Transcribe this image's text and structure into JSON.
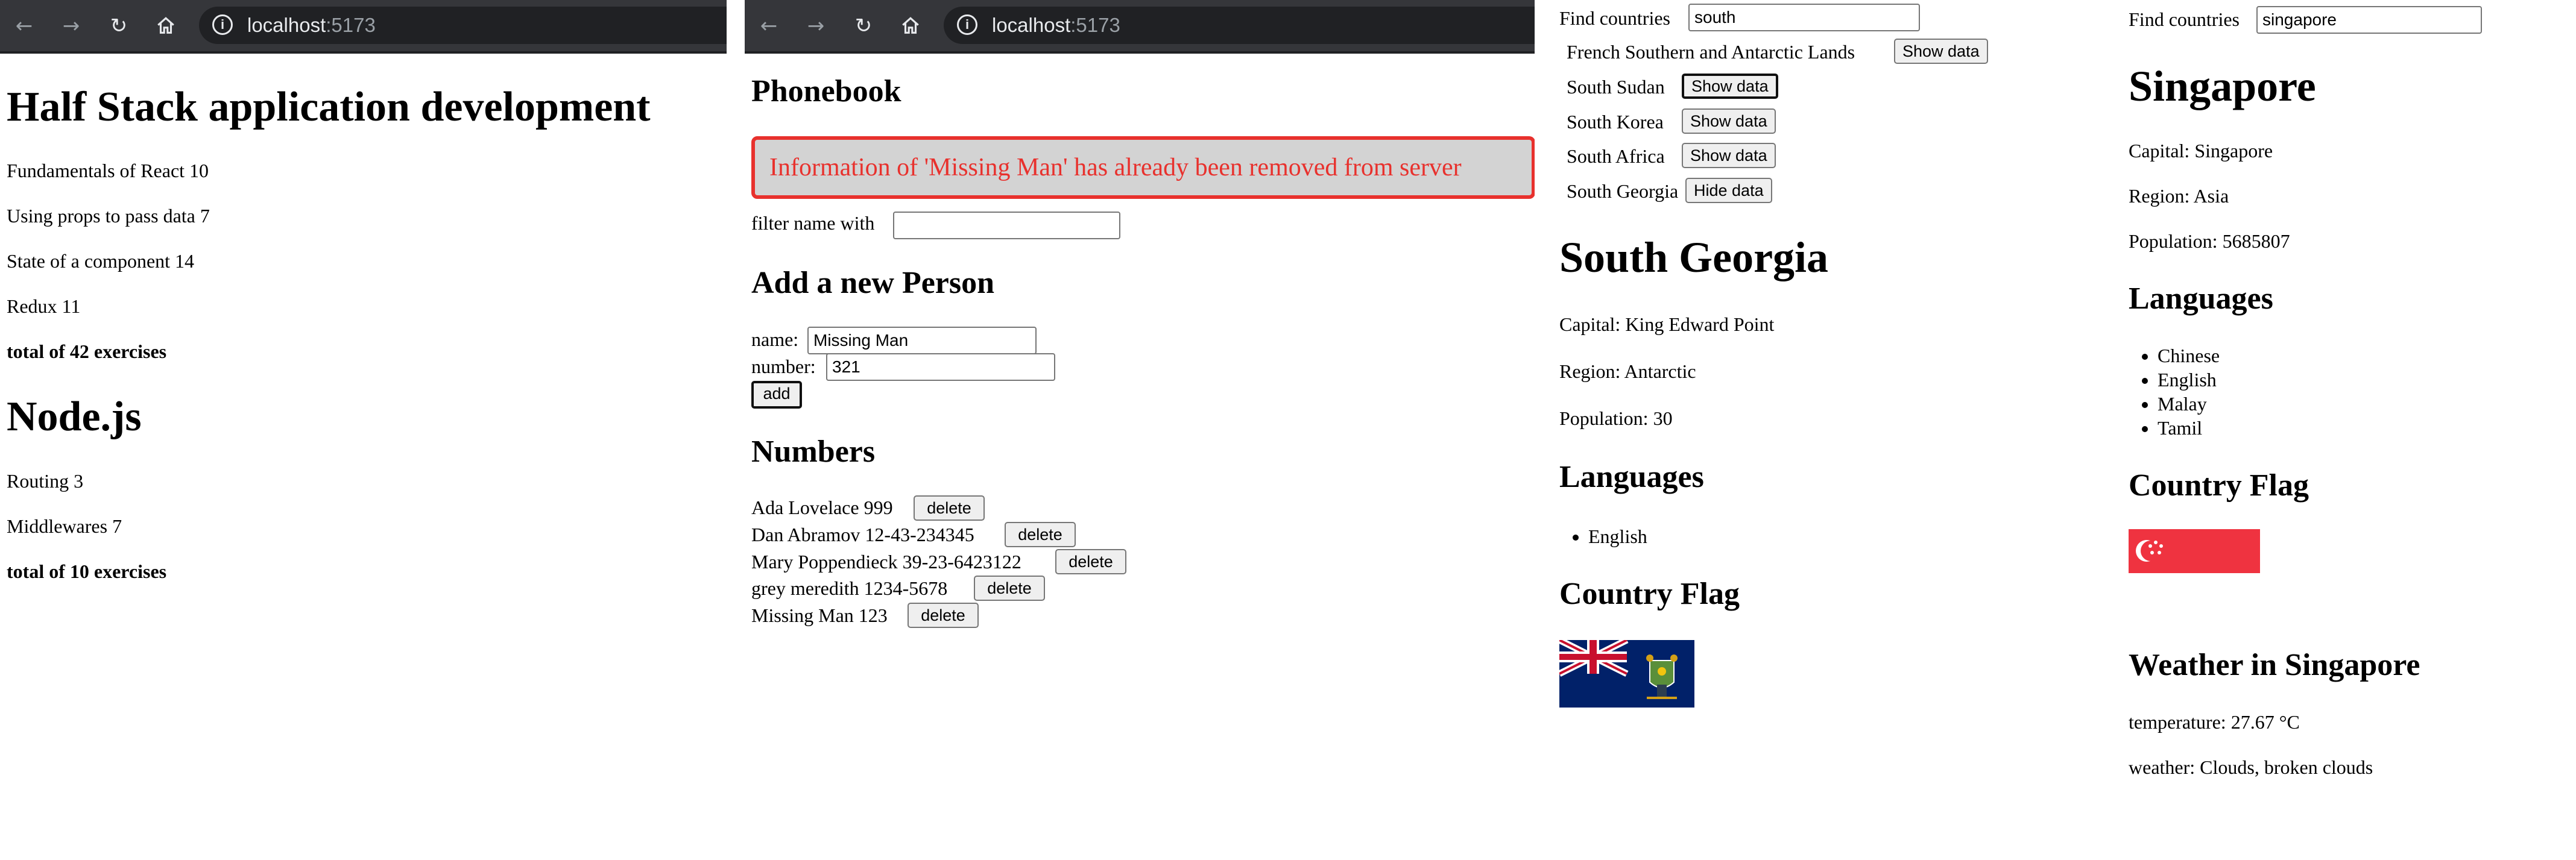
{
  "browser": {
    "url_host": "localhost",
    "url_port": ":5173",
    "back_icon": "arrow-left-icon",
    "forward_icon": "arrow-right-icon",
    "reload_icon": "reload-icon",
    "home_icon": "home-icon",
    "info_icon": "info-icon"
  },
  "courses": {
    "title": "Half Stack application development",
    "parts": [
      "Fundamentals of React 10",
      "Using props to pass data 7",
      "State of a component 14",
      "Redux 11"
    ],
    "total": "total of 42 exercises",
    "title2": "Node.js",
    "parts2": [
      "Routing 3",
      "Middlewares 7"
    ],
    "total2": "total of 10 exercises"
  },
  "phonebook": {
    "title": "Phonebook",
    "notification": "Information of 'Missing Man' has already been removed from server",
    "filter_label": "filter name with",
    "filter_value": "",
    "add_title": "Add a new Person",
    "name_label": "name:",
    "name_value": "Missing Man",
    "number_label": "number:",
    "number_value": "321",
    "add_button": "add",
    "numbers_title": "Numbers",
    "delete_label": "delete",
    "persons": [
      "Ada Lovelace 999",
      "Dan Abramov 12-43-234345",
      "Mary Poppendieck 39-23-6423122",
      "grey meredith 1234-5678",
      "Missing Man 123"
    ]
  },
  "countries_south": {
    "find_label": "Find countries",
    "find_value": "south",
    "results": [
      {
        "name": "French Southern and Antarctic Lands",
        "button": "Show data"
      },
      {
        "name": "South Sudan",
        "button": "Show data"
      },
      {
        "name": "South Korea",
        "button": "Show data"
      },
      {
        "name": "South Africa",
        "button": "Show data"
      },
      {
        "name": "South Georgia",
        "button": "Hide data"
      }
    ],
    "country_name": "South Georgia",
    "capital": "Capital: King Edward Point",
    "region": "Region: Antarctic",
    "population": "Population: 30",
    "languages_title": "Languages",
    "languages": [
      "English"
    ],
    "flag_title": "Country Flag",
    "flag_icon": "south-georgia-flag-icon"
  },
  "countries_singapore": {
    "find_label": "Find countries",
    "find_value": "singapore",
    "country_name": "Singapore",
    "capital": "Capital: Singapore",
    "region": "Region: Asia",
    "population": "Population: 5685807",
    "languages_title": "Languages",
    "languages": [
      "Chinese",
      "English",
      "Malay",
      "Tamil"
    ],
    "flag_title": "Country Flag",
    "flag_icon": "singapore-flag-icon",
    "weather_title": "Weather in Singapore",
    "temperature": "temperature: 27.67 °C",
    "weather": "weather: Clouds, broken clouds"
  },
  "colors": {
    "chrome_bg": "#35363a",
    "notification_red": "#e8312d",
    "notification_bg": "#d3d3d3",
    "flag_red": "#ef3340",
    "flag_blue": "#012169"
  }
}
